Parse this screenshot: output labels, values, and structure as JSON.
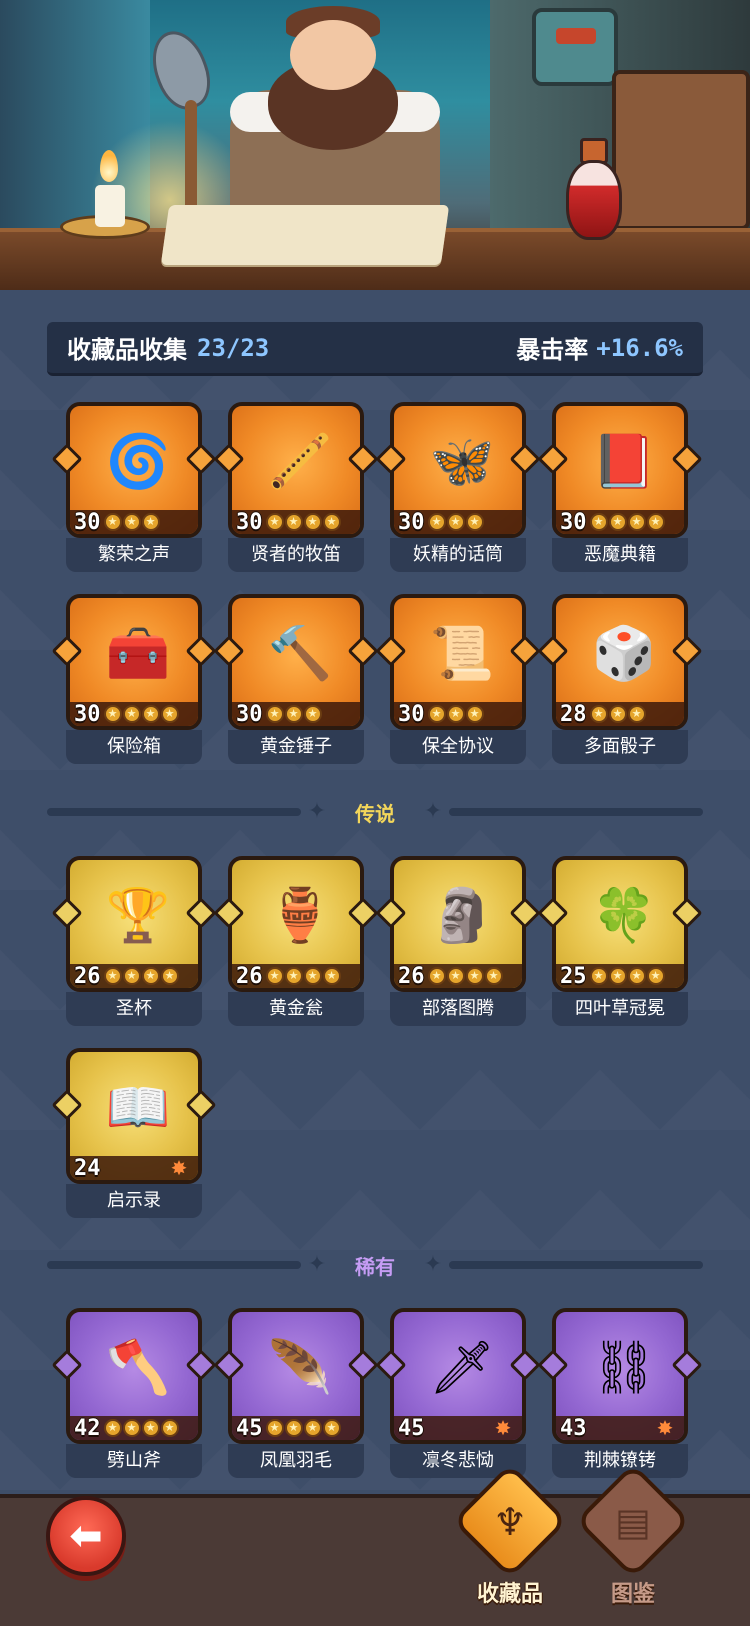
{
  "header": {
    "title": "收藏品收集",
    "count": "23/23",
    "crit_label": "暴击率",
    "crit_value": "+16.6%"
  },
  "sections": {
    "legend": "传说",
    "rare": "稀有"
  },
  "epic_items": [
    {
      "name": "繁荣之声",
      "level": "30",
      "stars": 3,
      "max": 3,
      "icon": "orb-icon",
      "glyph": "🌀"
    },
    {
      "name": "贤者的牧笛",
      "level": "30",
      "stars": 4,
      "max": 4,
      "icon": "flute-icon",
      "glyph": "🪈"
    },
    {
      "name": "妖精的话筒",
      "level": "30",
      "stars": 3,
      "max": 3,
      "icon": "butterfly-mic-icon",
      "glyph": "🦋"
    },
    {
      "name": "恶魔典籍",
      "level": "30",
      "stars": 4,
      "max": 4,
      "icon": "demon-book-icon",
      "glyph": "📕"
    },
    {
      "name": "保险箱",
      "level": "30",
      "stars": 4,
      "max": 4,
      "icon": "treasure-chest-icon",
      "glyph": "🧰"
    },
    {
      "name": "黄金锤子",
      "level": "30",
      "stars": 3,
      "max": 3,
      "icon": "hammer-icon",
      "glyph": "🔨"
    },
    {
      "name": "保全协议",
      "level": "30",
      "stars": 3,
      "max": 3,
      "icon": "contract-icon",
      "glyph": "📜"
    },
    {
      "name": "多面骰子",
      "level": "28",
      "stars": 3,
      "max": 3,
      "icon": "dice-icon",
      "glyph": "🎲"
    }
  ],
  "legend_items": [
    {
      "name": "圣杯",
      "level": "26",
      "stars": 4,
      "max": 4,
      "icon": "grail-icon",
      "glyph": "🏆"
    },
    {
      "name": "黄金瓮",
      "level": "26",
      "stars": 4,
      "max": 4,
      "icon": "urn-icon",
      "glyph": "🏺"
    },
    {
      "name": "部落图腾",
      "level": "26",
      "stars": 4,
      "max": 4,
      "icon": "totem-icon",
      "glyph": "🗿"
    },
    {
      "name": "四叶草冠冕",
      "level": "25",
      "stars": 4,
      "max": 4,
      "icon": "clover-crown-icon",
      "glyph": "🍀"
    },
    {
      "name": "启示录",
      "level": "24",
      "stars": 0,
      "max": 0,
      "burst": true,
      "icon": "open-book-icon",
      "glyph": "📖"
    }
  ],
  "rare_items": [
    {
      "name": "劈山斧",
      "level": "42",
      "stars": 4,
      "max": 4,
      "icon": "axe-icon",
      "glyph": "🪓"
    },
    {
      "name": "凤凰羽毛",
      "level": "45",
      "stars": 4,
      "max": 4,
      "icon": "phoenix-feather-icon",
      "glyph": "🪶"
    },
    {
      "name": "凛冬悲恸",
      "level": "45",
      "stars": 0,
      "max": 0,
      "burst": true,
      "icon": "ice-sword-icon",
      "glyph": "🗡"
    },
    {
      "name": "荆棘镣铐",
      "level": "43",
      "stars": 0,
      "max": 0,
      "burst": true,
      "icon": "thorn-shackle-icon",
      "glyph": "⛓"
    }
  ],
  "nav": {
    "back_glyph": "⬅",
    "tabs": [
      {
        "label": "收藏品",
        "icon": "harp-icon",
        "glyph": "♆",
        "active": true
      },
      {
        "label": "图鉴",
        "icon": "book-icon",
        "glyph": "▤",
        "active": false
      }
    ]
  },
  "colors": {
    "background": "#3e4e69",
    "epic": "#f08a26",
    "legend": "#e6c24a",
    "rare": "#9468d2",
    "accent_blue": "#8ec6ff"
  }
}
